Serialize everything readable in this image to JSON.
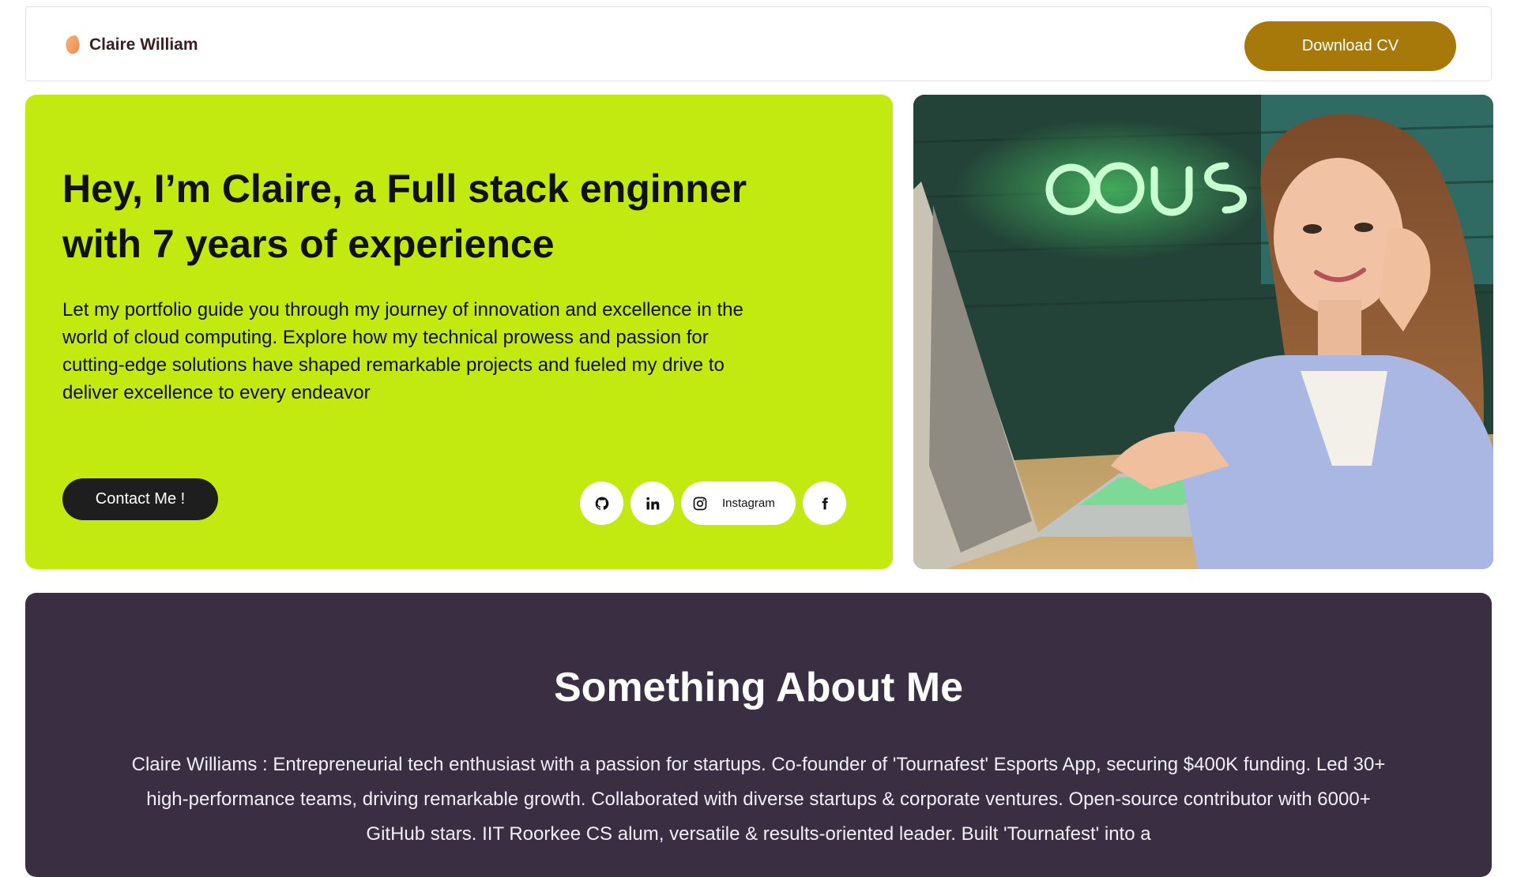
{
  "header": {
    "brand_name": "Claire William",
    "download_label": "Download CV"
  },
  "hero": {
    "title": "Hey, I’m Claire, a Full stack enginner with 7 years of experience",
    "description": "Let my portfolio guide you through my journey of innovation and excellence in the world of cloud computing. Explore how my technical prowess and passion for cutting-edge solutions have shaped remarkable projects and fueled my drive to deliver excellence to every endeavor",
    "contact_label": "Contact Me !",
    "socials": [
      {
        "icon": "github-icon"
      },
      {
        "icon": "linkedin-icon"
      },
      {
        "icon": "instagram-icon",
        "label": "Instagram"
      },
      {
        "icon": "facebook-icon"
      }
    ]
  },
  "about": {
    "title": "Something About Me",
    "text": "Claire Williams : Entrepreneurial tech enthusiast with a passion for startups. Co-founder of 'Tournafest' Esports App, securing $400K funding. Led 30+ high-performance teams, driving remarkable growth. Collaborated with diverse startups & corporate ventures. Open-source contributor with 6000+ GitHub stars. IIT Roorkee CS alum, versatile & results-oriented leader. Built 'Tournafest' into a"
  },
  "colors": {
    "hero_bg": "#c3ea10",
    "download_bg": "#a7790a",
    "about_bg": "#3a2e42",
    "contact_bg": "#1e1e1e"
  }
}
